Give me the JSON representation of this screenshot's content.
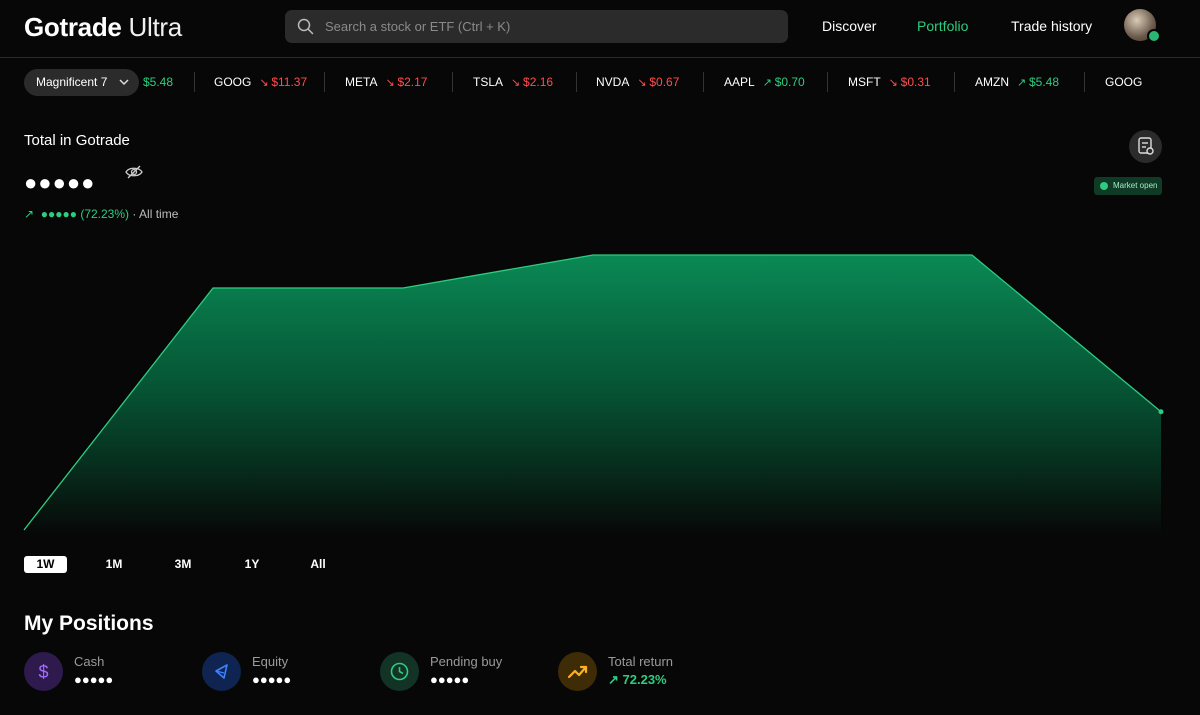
{
  "header": {
    "logo_bold": "Gotrade",
    "logo_light": "Ultra",
    "search_placeholder": "Search a stock or ETF (Ctrl + K)",
    "nav": [
      "Discover",
      "Portfolio",
      "Trade history"
    ],
    "active_nav": "Portfolio"
  },
  "ticker": {
    "watchlist": "Magnificent 7",
    "partial_left": "$5.48",
    "items": [
      {
        "symbol": "GOOG",
        "change": "$11.37",
        "direction": "down"
      },
      {
        "symbol": "META",
        "change": "$2.17",
        "direction": "down"
      },
      {
        "symbol": "TSLA",
        "change": "$2.16",
        "direction": "down"
      },
      {
        "symbol": "NVDA",
        "change": "$0.67",
        "direction": "down"
      },
      {
        "symbol": "AAPL",
        "change": "$0.70",
        "direction": "up"
      },
      {
        "symbol": "MSFT",
        "change": "$0.31",
        "direction": "down"
      },
      {
        "symbol": "AMZN",
        "change": "$5.48",
        "direction": "up"
      },
      {
        "symbol": "GOOG",
        "change": "",
        "direction": "down"
      }
    ]
  },
  "summary": {
    "label": "Total in Gotrade",
    "hidden_value": "●●●●●",
    "gain_hidden": "●●●●●",
    "gain_percent": "(72.23%)",
    "gain_period": "· All time",
    "market_status": "Market open"
  },
  "chart_data": {
    "type": "area",
    "values": [
      0,
      0.88,
      0.88,
      1.0,
      1.0,
      1.0,
      0.43
    ],
    "line_color": "#2ecc80",
    "grid": false
  },
  "ranges": {
    "items": [
      "1W",
      "1M",
      "3M",
      "1Y",
      "All"
    ],
    "active": "1W"
  },
  "positions": {
    "title": "My Positions",
    "cards": [
      {
        "label": "Cash",
        "value": "●●●●●",
        "icon": "dollar-icon"
      },
      {
        "label": "Equity",
        "value": "●●●●●",
        "icon": "pie-chart-icon"
      },
      {
        "label": "Pending buy",
        "value": "●●●●●",
        "icon": "clock-icon"
      },
      {
        "label": "Total return",
        "value": "72.23%",
        "icon": "trend-up-icon"
      }
    ]
  },
  "colors": {
    "accent": "#2ecc80",
    "down": "#ff4d4d",
    "background": "#070707"
  }
}
